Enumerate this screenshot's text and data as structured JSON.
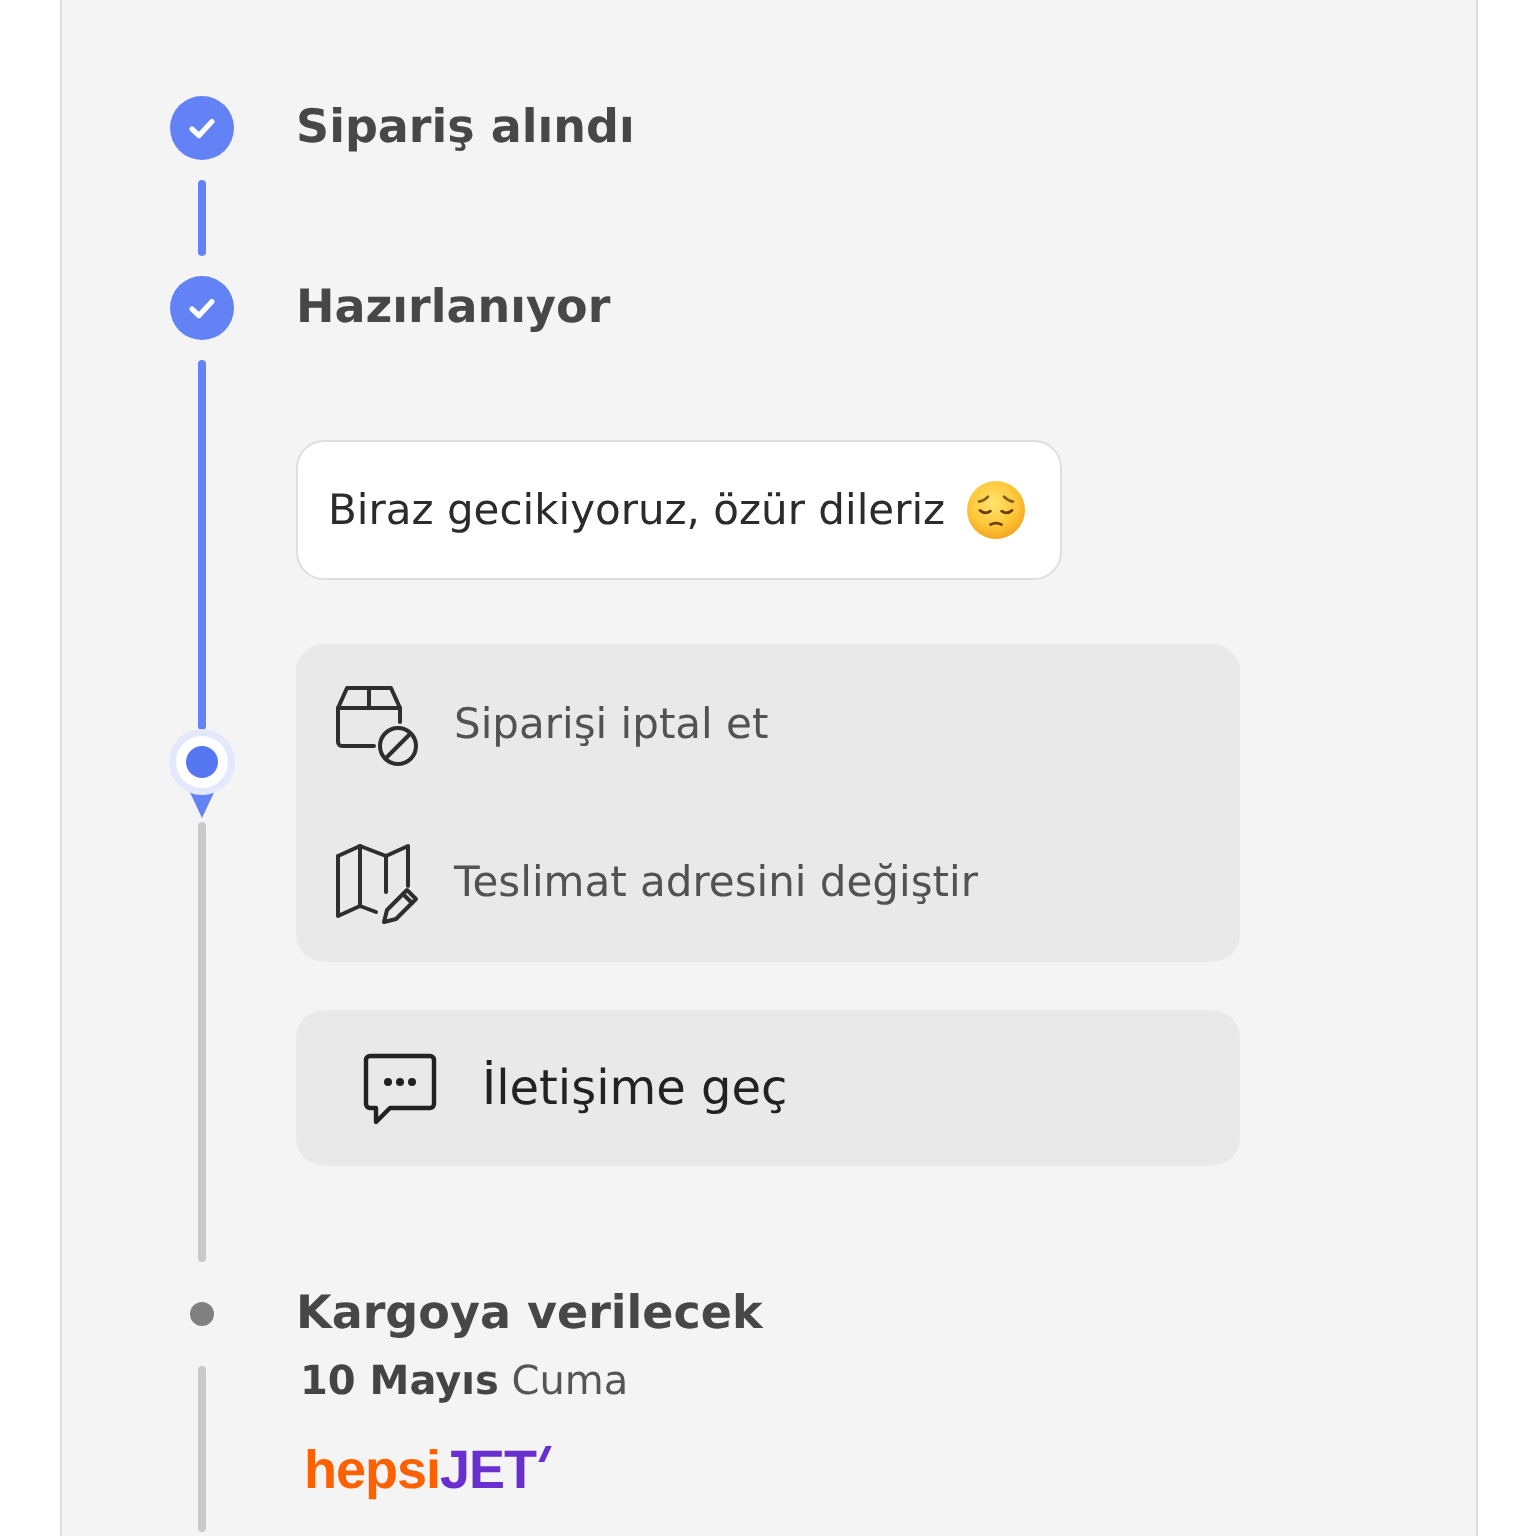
{
  "steps": [
    {
      "title": "Sipariş alındı",
      "completed": true,
      "marker": false
    },
    {
      "title": "Hazırlanıyor",
      "completed": true,
      "marker": true,
      "blocks": [
        {
          "kind": "notice",
          "text": "Biraz gecikiyoruz, özür dileriz"
        },
        {
          "kind": "actions",
          "items": [
            {
              "kind": "cancel",
              "label": "Siparişi iptal et"
            },
            {
              "kind": "address",
              "label": "Teslimat adresini değiştir"
            }
          ]
        },
        {
          "kind": "contact",
          "label": "İletişime geç"
        }
      ]
    },
    {
      "title": "Kargoya verilecek",
      "completed": false,
      "marker": false,
      "blocks": [
        {
          "kind": "date",
          "text": "**10 Mayıs** Cuma"
        },
        {
          "kind": "carrier",
          "logo": [
            "hepsi",
            "JET"
          ]
        }
      ]
    }
  ]
}
